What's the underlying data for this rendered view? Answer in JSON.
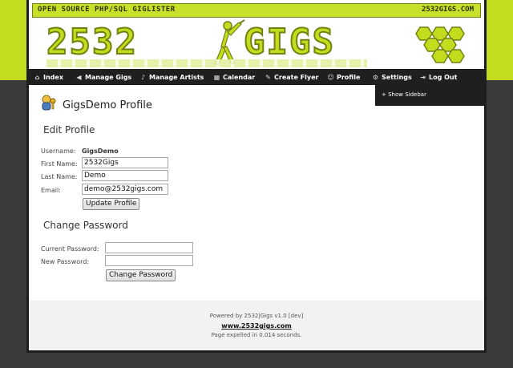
{
  "header": {
    "tagline": "OPEN SOURCE PHP/SQL GIGLISTER",
    "site": "2532GIGS.COM",
    "logo_left": "2532",
    "logo_right": "GIGS"
  },
  "nav": {
    "items": [
      {
        "label": "Index",
        "icon": "home-icon"
      },
      {
        "label": "Manage Gigs",
        "icon": "speaker-icon"
      },
      {
        "label": "Manage Artists",
        "icon": "guitar-icon"
      },
      {
        "label": "Calendar",
        "icon": "calendar-icon"
      },
      {
        "label": "Create Flyer",
        "icon": "flyer-icon"
      },
      {
        "label": "Profile",
        "icon": "profile-icon"
      },
      {
        "label": "Settings",
        "icon": "settings-icon"
      },
      {
        "label": "Log Out",
        "icon": "logout-icon"
      }
    ],
    "dropdown_item": "+ Show Sidebar"
  },
  "main": {
    "title": "GigsDemo Profile",
    "edit_heading": "Edit Profile",
    "username_label": "Username:",
    "username_value": "GigsDemo",
    "first_name_label": "First Name:",
    "first_name_value": "2532Gigs",
    "last_name_label": "Last Name:",
    "last_name_value": "Demo",
    "email_label": "Email:",
    "email_value": "demo@2532gigs.com",
    "update_button": "Update Profile",
    "password_heading": "Change Password",
    "current_password_label": "Current Password:",
    "new_password_label": "New Password:",
    "change_password_button": "Change Password"
  },
  "footer": {
    "powered": "Powered by 2532|Gigs v1.0 [dev]",
    "link": "www.2532gigs.com",
    "timing": "Page expelled in 0.014 seconds."
  },
  "colors": {
    "lime": "#c3dd1e",
    "dark_bg": "#3a3a3a",
    "nav_bg": "#1f1f1f"
  }
}
